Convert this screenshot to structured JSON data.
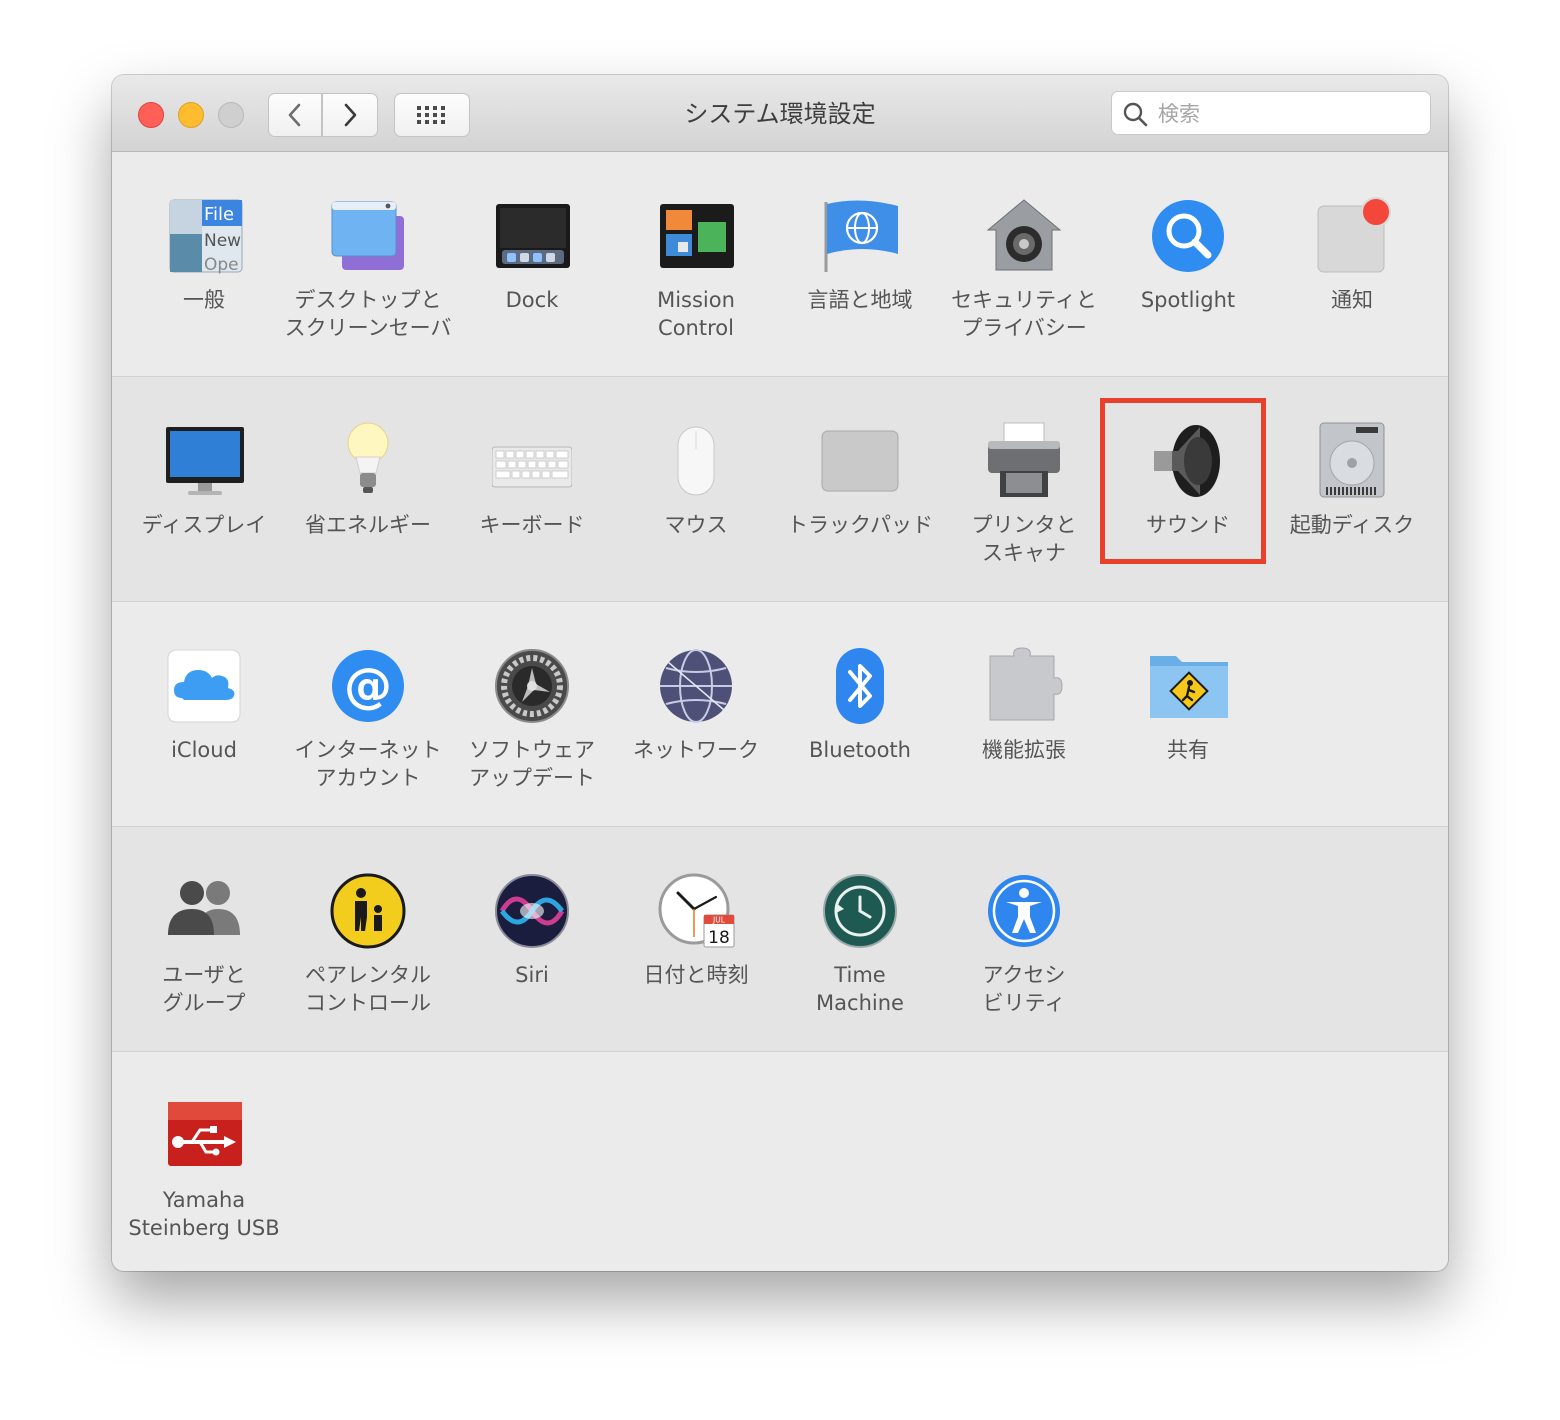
{
  "window": {
    "title": "システム環境設定",
    "search": {
      "placeholder": "検索",
      "value": ""
    }
  },
  "highlight_color": "#e8402b",
  "sections": [
    {
      "items": [
        {
          "id": "general",
          "label": "一般",
          "icon": "general-icon"
        },
        {
          "id": "desktop",
          "label": "デスクトップと\nスクリーンセーバ",
          "icon": "desktop-screensaver-icon"
        },
        {
          "id": "dock",
          "label": "Dock",
          "icon": "dock-icon"
        },
        {
          "id": "mission-control",
          "label": "Mission\nControl",
          "icon": "mission-control-icon"
        },
        {
          "id": "language",
          "label": "言語と地域",
          "icon": "flag-globe-icon"
        },
        {
          "id": "security",
          "label": "セキュリティと\nプライバシー",
          "icon": "house-lock-icon"
        },
        {
          "id": "spotlight",
          "label": "Spotlight",
          "icon": "magnifier-icon"
        },
        {
          "id": "notifications",
          "label": "通知",
          "icon": "notifications-icon"
        }
      ]
    },
    {
      "items": [
        {
          "id": "display",
          "label": "ディスプレイ",
          "icon": "monitor-icon"
        },
        {
          "id": "energy",
          "label": "省エネルギー",
          "icon": "lightbulb-icon"
        },
        {
          "id": "keyboard",
          "label": "キーボード",
          "icon": "keyboard-icon"
        },
        {
          "id": "mouse",
          "label": "マウス",
          "icon": "mouse-icon"
        },
        {
          "id": "trackpad",
          "label": "トラックパッド",
          "icon": "trackpad-icon"
        },
        {
          "id": "printers",
          "label": "プリンタと\nスキャナ",
          "icon": "printer-icon"
        },
        {
          "id": "sound",
          "label": "サウンド",
          "icon": "speaker-icon"
        },
        {
          "id": "startup-disk",
          "label": "起動ディスク",
          "icon": "hard-disk-icon"
        }
      ]
    },
    {
      "items": [
        {
          "id": "icloud",
          "label": "iCloud",
          "icon": "cloud-icon"
        },
        {
          "id": "internet-accounts",
          "label": "インターネット\nアカウント",
          "icon": "at-sign-icon"
        },
        {
          "id": "software-update",
          "label": "ソフトウェア\nアップデート",
          "icon": "gear-icon"
        },
        {
          "id": "network",
          "label": "ネットワーク",
          "icon": "network-globe-icon"
        },
        {
          "id": "bluetooth",
          "label": "Bluetooth",
          "icon": "bluetooth-icon"
        },
        {
          "id": "extensions",
          "label": "機能拡張",
          "icon": "puzzle-icon"
        },
        {
          "id": "sharing",
          "label": "共有",
          "icon": "sharing-folder-icon"
        }
      ]
    },
    {
      "items": [
        {
          "id": "users",
          "label": "ユーザと\nグループ",
          "icon": "users-icon"
        },
        {
          "id": "parental",
          "label": "ペアレンタル\nコントロール",
          "icon": "parental-icon"
        },
        {
          "id": "siri",
          "label": "Siri",
          "icon": "siri-icon"
        },
        {
          "id": "datetime",
          "label": "日付と時刻",
          "icon": "clock-calendar-icon",
          "calendar": {
            "month": "JUL",
            "day": "18"
          }
        },
        {
          "id": "time-machine",
          "label": "Time\nMachine",
          "icon": "time-machine-icon"
        },
        {
          "id": "accessibility",
          "label": "アクセシ\nビリティ",
          "icon": "accessibility-icon"
        }
      ]
    },
    {
      "items": [
        {
          "id": "yamaha",
          "label": "Yamaha\nSteinberg USB",
          "icon": "usb-driver-icon"
        }
      ]
    }
  ]
}
